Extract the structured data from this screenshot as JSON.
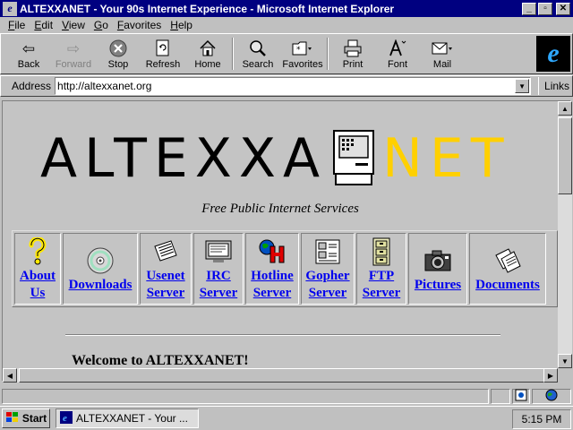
{
  "window": {
    "title": "ALTEXXANET - Your 90s Internet Experience - Microsoft Internet Explorer",
    "minimize_glyph": "_",
    "maximize_glyph": "▫",
    "close_glyph": "✕"
  },
  "menu": [
    "File",
    "Edit",
    "View",
    "Go",
    "Favorites",
    "Help"
  ],
  "toolbar": {
    "back": "Back",
    "forward": "Forward",
    "stop": "Stop",
    "refresh": "Refresh",
    "home": "Home",
    "search": "Search",
    "favorites": "Favorites",
    "print": "Print",
    "font": "Font",
    "mail": "Mail"
  },
  "address": {
    "label": "Address",
    "url": "http://altexxanet.org",
    "links_label": "Links"
  },
  "page": {
    "logo_left": "ALTEXXA",
    "logo_right": "NET",
    "logo_right_color": "#ffd000",
    "tagline": "Free Public Internet Services",
    "nav": [
      {
        "line1": "About",
        "line2": "Us",
        "icon": "question-icon"
      },
      {
        "line1": "Downloads",
        "line2": "",
        "icon": "cd-icon"
      },
      {
        "line1": "Usenet",
        "line2": "Server",
        "icon": "newspaper-icon"
      },
      {
        "line1": "IRC",
        "line2": "Server",
        "icon": "monitor-icon"
      },
      {
        "line1": "Hotline",
        "line2": "Server",
        "icon": "hotline-icon"
      },
      {
        "line1": "Gopher",
        "line2": "Server",
        "icon": "gopher-icon"
      },
      {
        "line1": "FTP",
        "line2": "Server",
        "icon": "cabinet-icon"
      },
      {
        "line1": "Pictures",
        "line2": "",
        "icon": "camera-icon"
      },
      {
        "line1": "Documents",
        "line2": "",
        "icon": "documents-icon"
      }
    ],
    "welcome": "Welcome to ALTEXXANET!",
    "link_color": "#0000ee"
  },
  "taskbar": {
    "start": "Start",
    "task": "ALTEXXANET - Your ...",
    "clock": "5:15 PM"
  }
}
